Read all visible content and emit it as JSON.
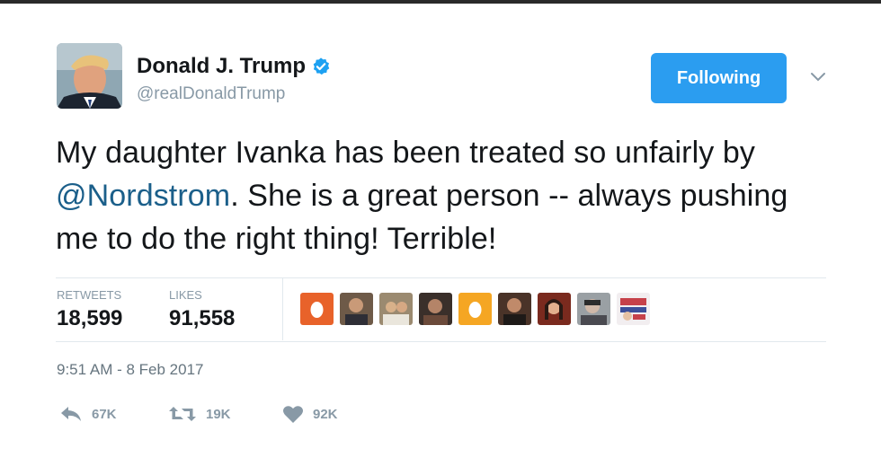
{
  "user": {
    "name": "Donald J. Trump",
    "handle": "@realDonaldTrump",
    "verified": true
  },
  "follow_button": {
    "label": "Following"
  },
  "tweet": {
    "text_part1": "My daughter Ivanka has been treated so unfairly by ",
    "mention": "@Nordstrom",
    "text_part2": ". She is a great person -- always pushing me to do the right thing! Terrible!"
  },
  "stats": {
    "retweets_label": "RETWEETS",
    "retweets_value": "18,599",
    "likes_label": "LIKES",
    "likes_value": "91,558"
  },
  "timestamp": "9:51 AM - 8 Feb 2017",
  "actions": {
    "reply_count": "67K",
    "retweet_count": "19K",
    "like_count": "92K"
  },
  "colors": {
    "follow_button": "#2b9df0",
    "mention": "#1b5f8a",
    "verified": "#1da1f2",
    "muted": "#8899a6"
  }
}
